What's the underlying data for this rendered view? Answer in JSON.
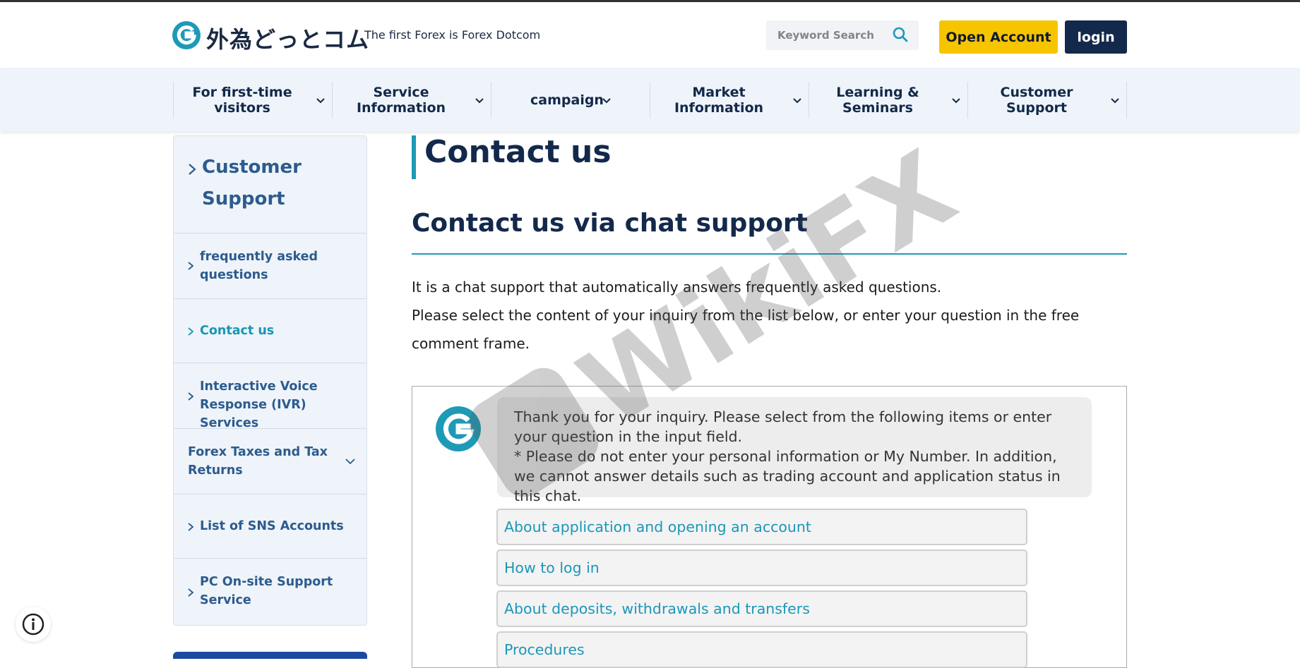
{
  "header": {
    "logo_text": "外為どっとコム",
    "tagline": "The first Forex is Forex Dotcom",
    "search_placeholder": "Keyword Search",
    "open_account_label": "Open Account",
    "login_label": "login"
  },
  "nav": {
    "items": [
      {
        "label": "For first-time visitors"
      },
      {
        "label": "Service Information"
      },
      {
        "label": "campaign"
      },
      {
        "label": "Market Information"
      },
      {
        "label": "Learning & Seminars"
      },
      {
        "label": "Customer Support"
      }
    ]
  },
  "sidebar": {
    "heading": "Customer Support",
    "items": [
      {
        "label": "frequently asked questions"
      },
      {
        "label": "Contact us"
      },
      {
        "label": "Interactive Voice Response (IVR) Services"
      },
      {
        "label": "Forex Taxes and Tax Returns"
      },
      {
        "label": "List of SNS Accounts"
      },
      {
        "label": "PC On-site Support Service"
      }
    ]
  },
  "main": {
    "page_title": "Contact us",
    "section_title": "Contact us via chat support",
    "desc_line1": "It is a chat support that automatically answers frequently asked questions.",
    "desc_line2": "Please select the content of your inquiry from the list below, or enter your question in the free comment frame.",
    "chat": {
      "message_line1": "Thank you for your inquiry. Please select from the following items or enter your question in the input field.",
      "message_line2": "* Please do not enter your personal information or My Number. In addition, we cannot answer details such as trading account and application status in this chat.",
      "options": [
        "About application and opening an account",
        "How to log in",
        "About deposits, withdrawals and transfers",
        "Procedures"
      ]
    }
  },
  "watermark": {
    "text": "WikiFX"
  },
  "colors": {
    "navy": "#13294b",
    "teal": "#1e9ab7",
    "yellow": "#f7c500",
    "nav_bg": "#eef4f9",
    "link_blue": "#2d5b8f"
  }
}
